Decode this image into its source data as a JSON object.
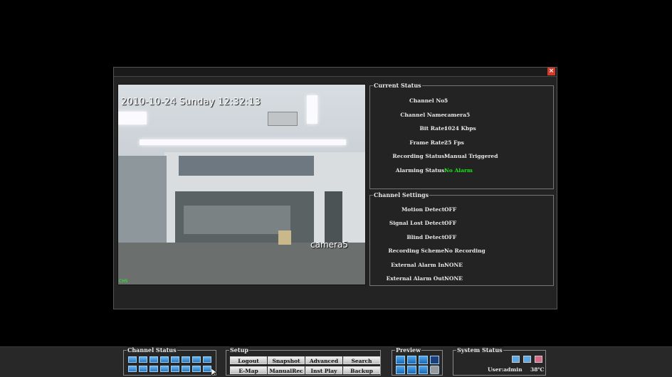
{
  "dialog": {
    "close_label": "×",
    "video": {
      "timestamp": "2010-10-24 Sunday 12:32:13",
      "camera_label": "camera5",
      "channel_tag": "CH5"
    },
    "current_status": {
      "title": "Current Status",
      "rows": [
        {
          "label": "Channel No:",
          "value": "5"
        },
        {
          "label": "Channel Name:",
          "value": "camera5"
        },
        {
          "label": "Bit Rate:",
          "value": "1024 Kbps"
        },
        {
          "label": "Frame Rate:",
          "value": "25 Fps"
        },
        {
          "label": "Recording Status:",
          "value": "Manual Triggered"
        },
        {
          "label": "Alarming Status:",
          "value": "No Alarm"
        }
      ]
    },
    "channel_settings": {
      "title": "Channel Settings",
      "rows": [
        {
          "label": "Motion Detect:",
          "value": "OFF"
        },
        {
          "label": "Signal Lost Detect:",
          "value": "OFF"
        },
        {
          "label": "Blind Detect:",
          "value": "OFF"
        },
        {
          "label": "Recording Scheme:",
          "value": "No Recording"
        },
        {
          "label": "External Alarm In:",
          "value": "NONE"
        },
        {
          "label": "External Alarm Out:",
          "value": "NONE"
        }
      ]
    }
  },
  "bottom_bar": {
    "channel_status": {
      "title": "Channel Status"
    },
    "setup": {
      "title": "Setup",
      "buttons": [
        "Logout",
        "Snapshot",
        "Advanced",
        "Search",
        "E-Map",
        "ManualRec",
        "Inst Play",
        "Backup"
      ]
    },
    "preview": {
      "title": "Preview"
    },
    "system_status": {
      "title": "System Status",
      "user": "User:admin",
      "temperature": "38℃"
    }
  },
  "colors": {
    "alarm_ok": "#18e018",
    "close": "#d23a2a",
    "channel_button": "#2a78c4"
  }
}
